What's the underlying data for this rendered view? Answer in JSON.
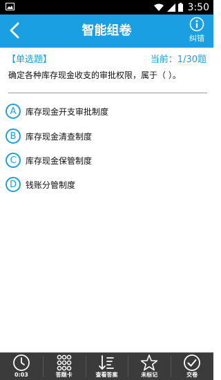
{
  "status_bar": {
    "time": "3:50"
  },
  "header": {
    "title": "智能组卷",
    "correct_label": "纠错"
  },
  "question": {
    "type_label": "【单选题】",
    "progress": "当前：1/30题",
    "text": "确定各种库存现金收支的审批权限，属于（      ）。",
    "options": [
      {
        "letter": "A",
        "text": "库存现金开支审批制度"
      },
      {
        "letter": "B",
        "text": "库存现金清查制度"
      },
      {
        "letter": "C",
        "text": "库存现金保管制度"
      },
      {
        "letter": "D",
        "text": "钱账分管制度"
      }
    ]
  },
  "bottom_bar": {
    "timer": "0:03",
    "answer_card": "答题卡",
    "view_answer": "查看答案",
    "unmarked": "未标记",
    "submit": "交卷"
  },
  "colors": {
    "accent": "#1aa0e2",
    "bottom_bar": "#3b3b3b"
  }
}
